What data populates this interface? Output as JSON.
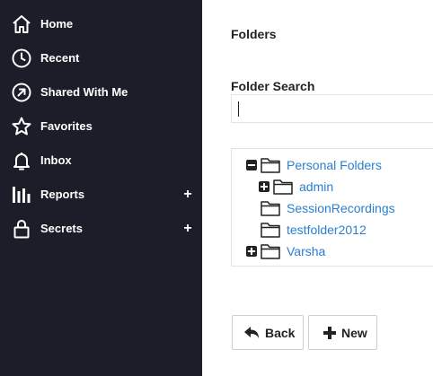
{
  "sidebar": {
    "items": [
      {
        "label": "Home",
        "icon": "home-icon"
      },
      {
        "label": "Recent",
        "icon": "clock-icon"
      },
      {
        "label": "Shared With Me",
        "icon": "share-arrow-icon"
      },
      {
        "label": "Favorites",
        "icon": "star-icon"
      },
      {
        "label": "Inbox",
        "icon": "bell-icon"
      },
      {
        "label": "Reports",
        "icon": "bar-chart-icon",
        "expand": "+"
      },
      {
        "label": "Secrets",
        "icon": "lock-icon",
        "expand": "+"
      }
    ]
  },
  "main": {
    "title": "Folders",
    "search": {
      "label": "Folder Search",
      "value": "",
      "placeholder": ""
    },
    "tree": [
      {
        "label": "Personal Folders",
        "toggle": "collapse",
        "depth": 0
      },
      {
        "label": "admin",
        "toggle": "expand",
        "depth": 1
      },
      {
        "label": "SessionRecordings",
        "toggle": "none",
        "depth": 1
      },
      {
        "label": "testfolder2012",
        "toggle": "none",
        "depth": 1
      },
      {
        "label": "Varsha",
        "toggle": "expand",
        "depth": 0
      }
    ],
    "buttons": {
      "back": "Back",
      "new": "New"
    }
  },
  "colors": {
    "sidebar_bg": "#1b1e28",
    "link": "#2a7fcf",
    "text": "#222222"
  }
}
